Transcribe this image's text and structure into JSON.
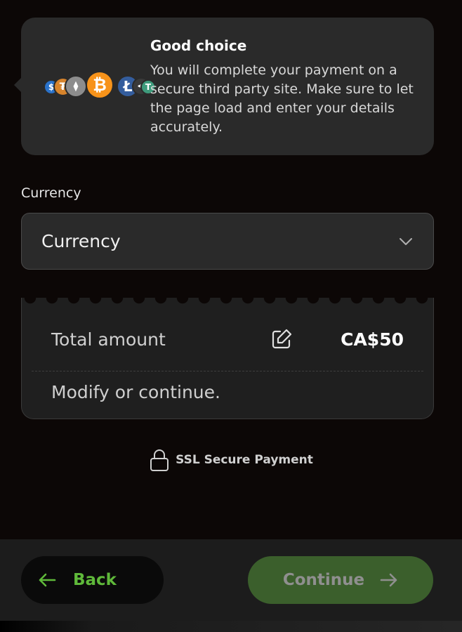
{
  "info": {
    "title": "Good choice",
    "body": "You will complete your payment on a secure third party site. Make sure to let the page load and enter your details accurately.",
    "coins": [
      {
        "symbol": "$",
        "color": "#2a72c9"
      },
      {
        "symbol": "₮",
        "color": "#d7842c"
      },
      {
        "symbol": "⧫",
        "color": "#8d8d8d"
      },
      {
        "symbol": "₿",
        "color": "#f7931a"
      },
      {
        "symbol": "Ł",
        "color": "#345d9d"
      },
      {
        "symbol": "<",
        "color": "#3a3a3a"
      },
      {
        "symbol": "T",
        "color": "#3e9b7c"
      }
    ]
  },
  "currency": {
    "label": "Currency",
    "selected": "Currency",
    "icon": "chevron-down-icon"
  },
  "amount": {
    "label": "Total amount",
    "value": "CA$50",
    "hint": "Modify or continue.",
    "edit_icon": "edit-icon"
  },
  "ssl": {
    "text": "SSL Secure Payment",
    "icon": "lock-icon"
  },
  "footer": {
    "back_label": "Back",
    "continue_label": "Continue"
  },
  "colors": {
    "accent_green": "#5fb93a",
    "continue_bg": "#3b5f2c",
    "card_bg": "#2a2a2a",
    "page_bg": "#0c0706"
  }
}
